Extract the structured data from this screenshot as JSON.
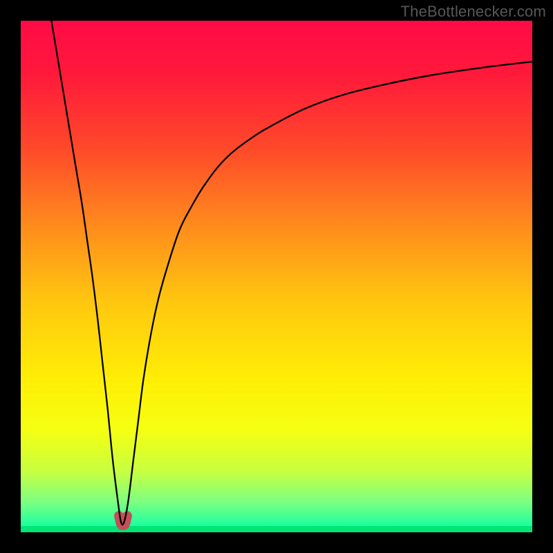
{
  "watermark": {
    "text": "TheBottlenecker.com"
  },
  "chart_data": {
    "type": "line",
    "title": "",
    "xlabel": "",
    "ylabel": "",
    "xlim": [
      0,
      100
    ],
    "ylim": [
      0,
      100
    ],
    "grid": false,
    "background": {
      "type": "vertical-gradient",
      "stops": [
        {
          "offset": 0.0,
          "color": "#ff0b47"
        },
        {
          "offset": 0.1,
          "color": "#ff183b"
        },
        {
          "offset": 0.25,
          "color": "#ff492a"
        },
        {
          "offset": 0.4,
          "color": "#ff8b1c"
        },
        {
          "offset": 0.55,
          "color": "#ffc70f"
        },
        {
          "offset": 0.7,
          "color": "#ffee05"
        },
        {
          "offset": 0.8,
          "color": "#f5ff12"
        },
        {
          "offset": 0.88,
          "color": "#c8ff3f"
        },
        {
          "offset": 0.94,
          "color": "#7eff81"
        },
        {
          "offset": 1.0,
          "color": "#00ffa8"
        }
      ]
    },
    "series": [
      {
        "name": "bottleneck-curve",
        "color": "#000000",
        "stroke_width": 2.3,
        "x": [
          6,
          7,
          8,
          9,
          10,
          11,
          12,
          13,
          14,
          15,
          16,
          17,
          18,
          19,
          19.6,
          20.2,
          21,
          22,
          23,
          24,
          25.5,
          27,
          29,
          31,
          33,
          36,
          40,
          45,
          50,
          56,
          63,
          71,
          80,
          90,
          100
        ],
        "y": [
          100,
          94,
          88,
          82,
          76,
          70,
          64,
          57,
          50,
          42,
          33,
          24,
          14,
          6,
          2,
          2,
          6,
          14,
          22,
          30,
          39,
          46,
          53,
          59,
          63,
          68,
          73,
          77,
          80,
          83,
          85.5,
          87.5,
          89.3,
          90.8,
          92
        ]
      }
    ],
    "highlight": {
      "name": "optimal-range",
      "color": "#c25058",
      "stroke_width": 14,
      "x": [
        19.2,
        19.6,
        20.0,
        20.4,
        20.8
      ],
      "y": [
        3.2,
        1.6,
        1.4,
        1.6,
        3.2
      ]
    }
  }
}
